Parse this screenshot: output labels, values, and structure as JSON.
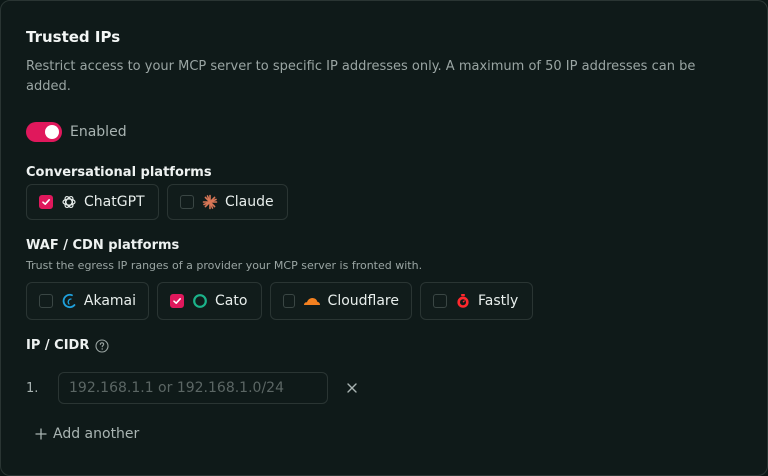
{
  "section": {
    "title": "Trusted IPs",
    "description": "Restrict access to your MCP server to specific IP addresses only. A maximum of 50 IP addresses can be added."
  },
  "toggle": {
    "label": "Enabled",
    "on": true
  },
  "conversational": {
    "label": "Conversational platforms",
    "items": [
      {
        "label": "ChatGPT",
        "checked": true,
        "icon": "openai-icon"
      },
      {
        "label": "Claude",
        "checked": false,
        "icon": "claude-icon"
      }
    ]
  },
  "waf": {
    "label": "WAF / CDN platforms",
    "help": "Trust the egress IP ranges of a provider your MCP server is fronted with.",
    "items": [
      {
        "label": "Akamai",
        "checked": false,
        "icon": "akamai-icon"
      },
      {
        "label": "Cato",
        "checked": true,
        "icon": "cato-icon"
      },
      {
        "label": "Cloudflare",
        "checked": false,
        "icon": "cloudflare-icon"
      },
      {
        "label": "Fastly",
        "checked": false,
        "icon": "fastly-icon"
      }
    ]
  },
  "ip": {
    "label": "IP / CIDR",
    "rows": [
      {
        "number": "1.",
        "value": "",
        "placeholder": "192.168.1.1 or 192.168.1.0/24"
      }
    ],
    "add_label": "Add another"
  },
  "colors": {
    "accent": "#e0185c",
    "background": "#0f1a19",
    "border": "#2a3533"
  }
}
